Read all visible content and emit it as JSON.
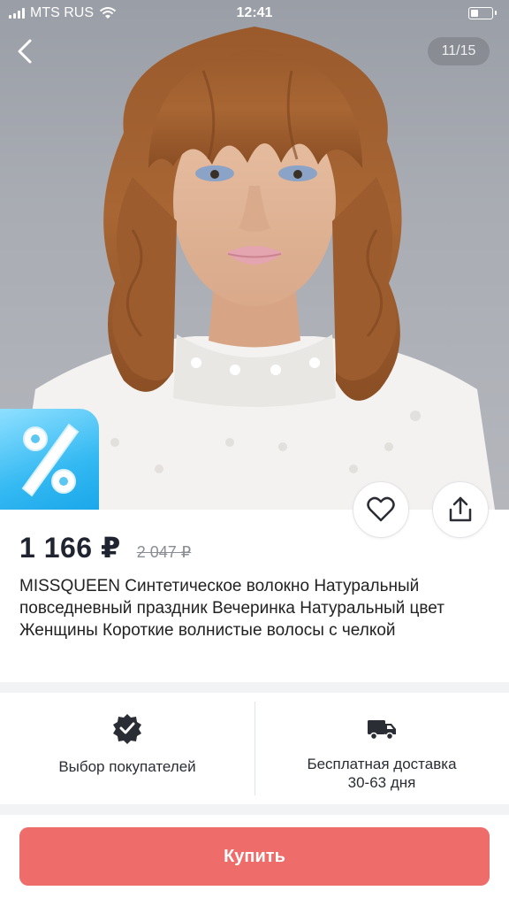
{
  "status_bar": {
    "carrier": "MTS RUS",
    "time": "12:41"
  },
  "gallery": {
    "counter": "11/15",
    "image": "wavy-brown-wig-on-mannequin-photo"
  },
  "product": {
    "price": "1 166 ₽",
    "old_price": "2 047 ₽",
    "title": "MISSQUEEN Синтетическое волокно Натуральный повседневный праздник Вечеринка Натуральный цвет Женщины Короткие волнистые волосы с челкой"
  },
  "features": [
    {
      "icon": "verified-badge-icon",
      "label": "Выбор покупателей"
    },
    {
      "icon": "delivery-truck-icon",
      "label_line1": "Бесплатная доставка",
      "label_line2": "30-63 дня"
    }
  ],
  "actions": {
    "buy_label": "Купить"
  },
  "colors": {
    "buy_button": "#ee6c6a",
    "discount_badge": "#34b9f2",
    "price_text": "#1f2430"
  }
}
